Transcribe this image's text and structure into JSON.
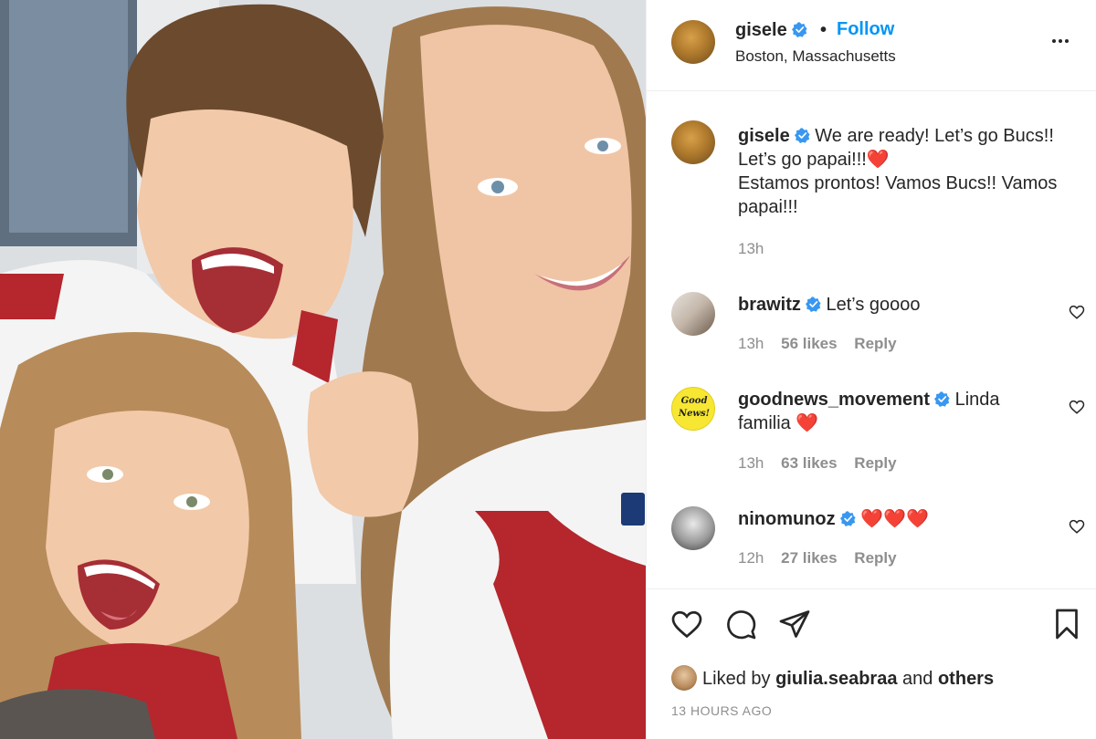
{
  "header": {
    "username": "gisele",
    "separator": "•",
    "follow_label": "Follow",
    "location": "Boston, Massachusetts"
  },
  "caption": {
    "username": "gisele",
    "text_line1": "We are ready! Let’s go Bucs!!",
    "text_line2": "Let’s go papai!!!❤️",
    "text_line3": "Estamos prontos! Vamos Bucs!! Vamos",
    "text_line4": "papai!!!",
    "time": "13h"
  },
  "comments": [
    {
      "username": "brawitz",
      "text": "Let’s goooo",
      "time": "13h",
      "likes": "56 likes",
      "reply": "Reply"
    },
    {
      "username": "goodnews_movement",
      "text": "Linda",
      "text2": "familia ❤️",
      "time": "13h",
      "likes": "63 likes",
      "reply": "Reply",
      "avatar_text_1": "Good",
      "avatar_text_2": "News!"
    },
    {
      "username": "ninomunoz",
      "text": "❤️❤️❤️",
      "time": "12h",
      "likes": "27 likes",
      "reply": "Reply"
    }
  ],
  "likes": {
    "prefix": "Liked by",
    "user": "giulia.seabraa",
    "and": "and",
    "others": "others"
  },
  "timestamp": "13 HOURS AGO",
  "colors": {
    "accent": "#0095f6",
    "text": "#262626",
    "muted": "#8e8e8e",
    "verified": "#3897f0",
    "heart": "#ed4956"
  },
  "icons": [
    "verified-badge-icon",
    "more-options-icon",
    "heart-icon",
    "comment-icon",
    "share-icon",
    "bookmark-icon"
  ]
}
